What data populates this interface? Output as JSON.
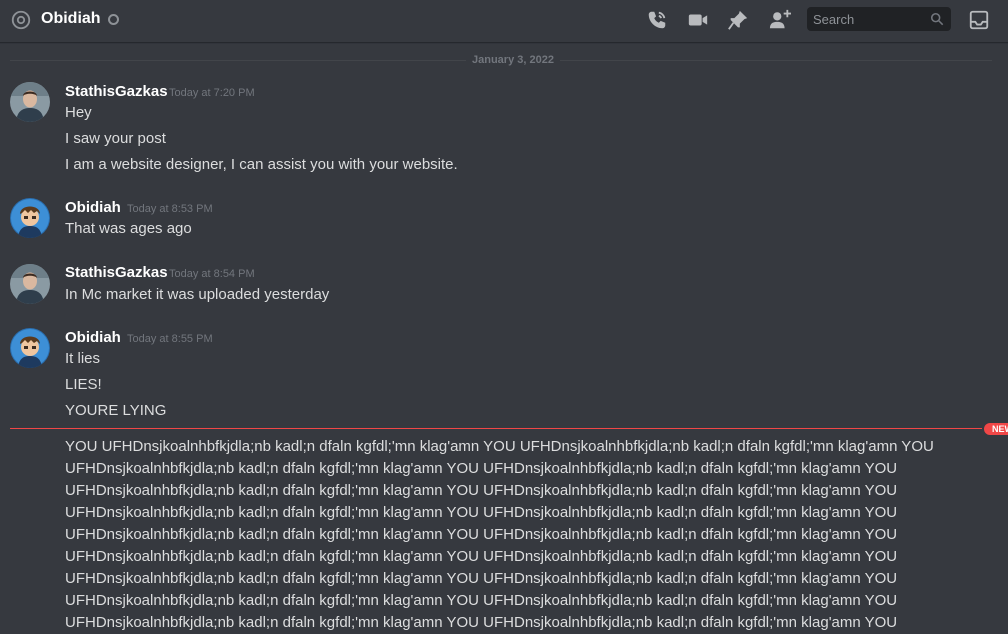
{
  "header": {
    "channel_name": "Obidiah",
    "search_placeholder": "Search",
    "icons": [
      "at-icon",
      "call-icon",
      "video-icon",
      "pin-icon",
      "add-friend-icon",
      "search-icon",
      "inbox-icon"
    ]
  },
  "divider": {
    "date": "January 3, 2022"
  },
  "messages": [
    {
      "author": "StathisGazkas",
      "timestamp": "Today at 7:20 PM",
      "lines": [
        "Hey",
        "I saw your post",
        "I am a website designer, I can assist you with your website."
      ]
    },
    {
      "author": "Obidiah",
      "timestamp": "Today at 8:53 PM",
      "lines": [
        "That was ages ago"
      ]
    },
    {
      "author": "StathisGazkas",
      "timestamp": "Today at 8:54 PM",
      "lines": [
        "In Mc market it was uploaded yesterday"
      ]
    },
    {
      "author": "Obidiah",
      "timestamp": "Today at 8:55 PM",
      "lines": [
        "It lies",
        "LIES!",
        "YOURE LYING"
      ]
    }
  ],
  "new_badge": "NEW",
  "spam_lines": [
    "YOU UFHDnsjkoalnhbfkjdla;nb kadl;n dfaln kgfdl;'mn klag'amn YOU UFHDnsjkoalnhbfkjdla;nb kadl;n dfaln kgfdl;'mn klag'amn YOU",
    "UFHDnsjkoalnhbfkjdla;nb kadl;n dfaln kgfdl;'mn klag'amn YOU UFHDnsjkoalnhbfkjdla;nb kadl;n dfaln kgfdl;'mn klag'amn YOU",
    "UFHDnsjkoalnhbfkjdla;nb kadl;n dfaln kgfdl;'mn klag'amn YOU UFHDnsjkoalnhbfkjdla;nb kadl;n dfaln kgfdl;'mn klag'amn YOU",
    "UFHDnsjkoalnhbfkjdla;nb kadl;n dfaln kgfdl;'mn klag'amn YOU UFHDnsjkoalnhbfkjdla;nb kadl;n dfaln kgfdl;'mn klag'amn YOU",
    "UFHDnsjkoalnhbfkjdla;nb kadl;n dfaln kgfdl;'mn klag'amn YOU UFHDnsjkoalnhbfkjdla;nb kadl;n dfaln kgfdl;'mn klag'amn YOU",
    "UFHDnsjkoalnhbfkjdla;nb kadl;n dfaln kgfdl;'mn klag'amn YOU UFHDnsjkoalnhbfkjdla;nb kadl;n dfaln kgfdl;'mn klag'amn YOU",
    "UFHDnsjkoalnhbfkjdla;nb kadl;n dfaln kgfdl;'mn klag'amn YOU UFHDnsjkoalnhbfkjdla;nb kadl;n dfaln kgfdl;'mn klag'amn YOU",
    "UFHDnsjkoalnhbfkjdla;nb kadl;n dfaln kgfdl;'mn klag'amn YOU UFHDnsjkoalnhbfkjdla;nb kadl;n dfaln kgfdl;'mn klag'amn YOU",
    "UFHDnsjkoalnhbfkjdla;nb kadl;n dfaln kgfdl;'mn klag'amn YOU UFHDnsjkoalnhbfkjdla;nb kadl;n dfaln kgfdl;'mn klag'amn YOU"
  ],
  "colors": {
    "background": "#36393f",
    "text": "#dcddde",
    "muted": "#72767d",
    "new_line": "#f04747"
  }
}
